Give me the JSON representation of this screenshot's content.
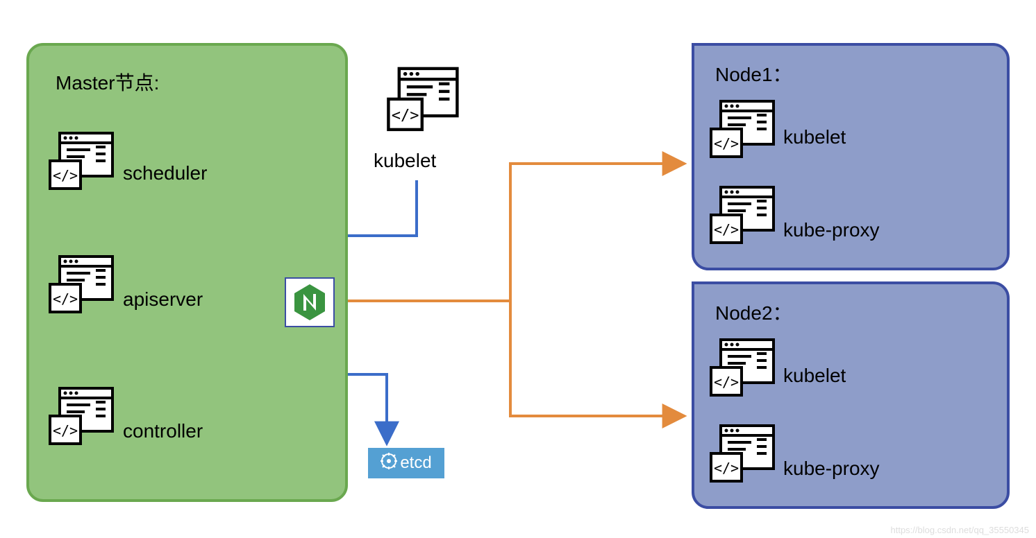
{
  "master": {
    "title": "Master节点:",
    "components": {
      "scheduler": "scheduler",
      "apiserver": "apiserver",
      "controller": "controller"
    }
  },
  "center": {
    "kubelet": "kubelet",
    "nginx_icon": "nginx-hexagon-icon",
    "etcd": "etcd"
  },
  "node1": {
    "title": "Node1：",
    "kubelet": "kubelet",
    "kubeproxy": "kube-proxy"
  },
  "node2": {
    "title": "Node2：",
    "kubelet": "kubelet",
    "kubeproxy": "kube-proxy"
  },
  "arrows": {
    "blue": "#3b6dc9",
    "orange": "#e38b3d",
    "black": "#000000"
  },
  "watermark": "https://blog.csdn.net/qq_35550345"
}
